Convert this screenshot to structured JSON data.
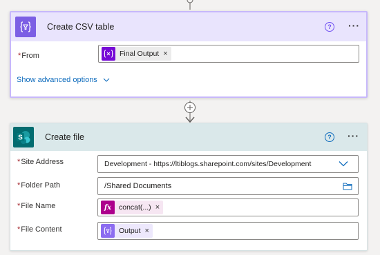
{
  "csv_card": {
    "title": "Create CSV table",
    "help_glyph": "?",
    "more_glyph": "···",
    "from_label": "From",
    "required_mark": "*",
    "from_token": "Final Output",
    "token_remove_glyph": "×",
    "advanced_link": "Show advanced options"
  },
  "create_file_card": {
    "title": "Create file",
    "help_glyph": "?",
    "more_glyph": "···",
    "required_mark": "*",
    "fields": {
      "site_address": {
        "label": "Site Address",
        "value": "Development - https://ltiblogs.sharepoint.com/sites/Development"
      },
      "folder_path": {
        "label": "Folder Path",
        "value": "/Shared Documents"
      },
      "file_name": {
        "label": "File Name",
        "token": "concat(...)"
      },
      "file_content": {
        "label": "File Content",
        "token": "Output"
      }
    },
    "token_remove_glyph": "×"
  },
  "icons": {
    "csv": "data-operation-icon",
    "sharepoint": "sharepoint-icon",
    "variable": "variable-icon",
    "expression": "expression-fx-icon",
    "output": "data-operation-icon"
  },
  "colors": {
    "csv_header": "#e9e4fd",
    "csv_accent": "#7c5fe4",
    "file_header": "#dae8ea",
    "sharepoint": "#036c70",
    "variable": "#770bd6",
    "expression": "#ad008c",
    "link": "#0f6cbd"
  }
}
